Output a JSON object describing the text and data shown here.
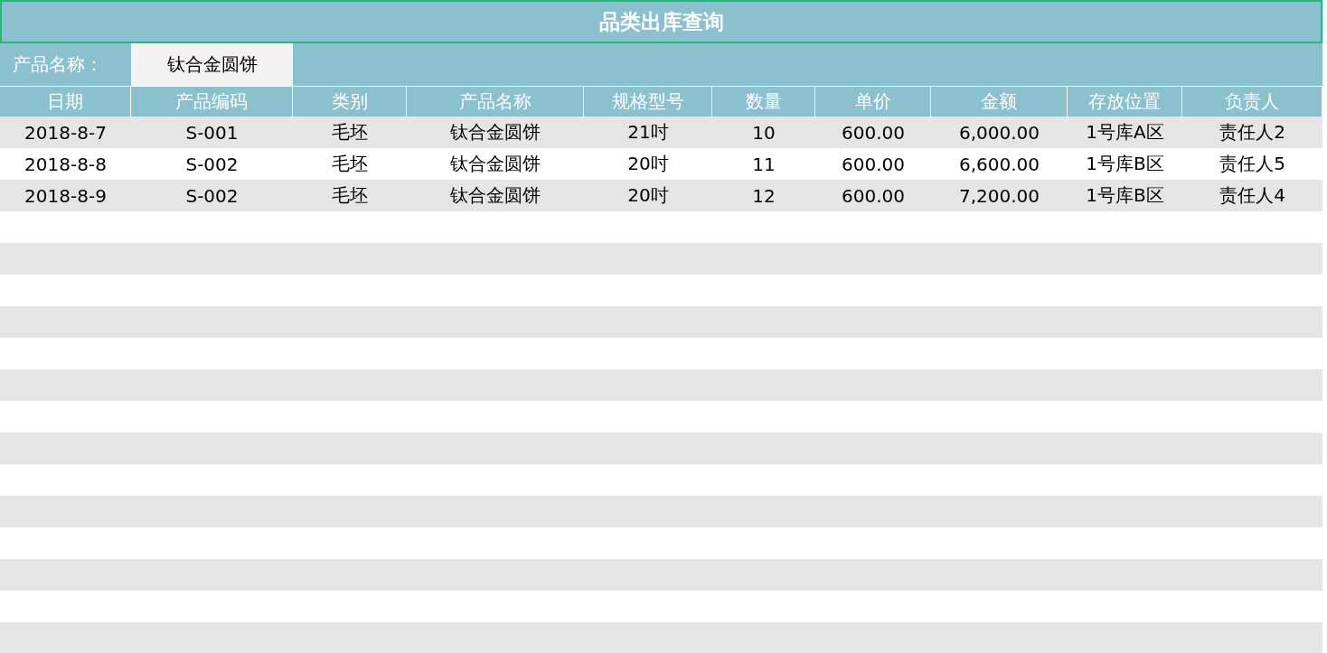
{
  "title": "品类出库查询",
  "filter": {
    "label": "产品名称：",
    "value": "钛合金圆饼"
  },
  "table": {
    "columns": [
      "日期",
      "产品编码",
      "类别",
      "产品名称",
      "规格型号",
      "数量",
      "单价",
      "金额",
      "存放位置",
      "负责人"
    ],
    "rows": [
      [
        "2018-8-7",
        "S-001",
        "毛坯",
        "钛合金圆饼",
        "21吋",
        "10",
        "600.00",
        "6,000.00",
        "1号库A区",
        "责任人2"
      ],
      [
        "2018-8-8",
        "S-002",
        "毛坯",
        "钛合金圆饼",
        "20吋",
        "11",
        "600.00",
        "6,600.00",
        "1号库B区",
        "责任人5"
      ],
      [
        "2018-8-9",
        "S-002",
        "毛坯",
        "钛合金圆饼",
        "20吋",
        "12",
        "600.00",
        "7,200.00",
        "1号库B区",
        "责任人4"
      ]
    ]
  }
}
